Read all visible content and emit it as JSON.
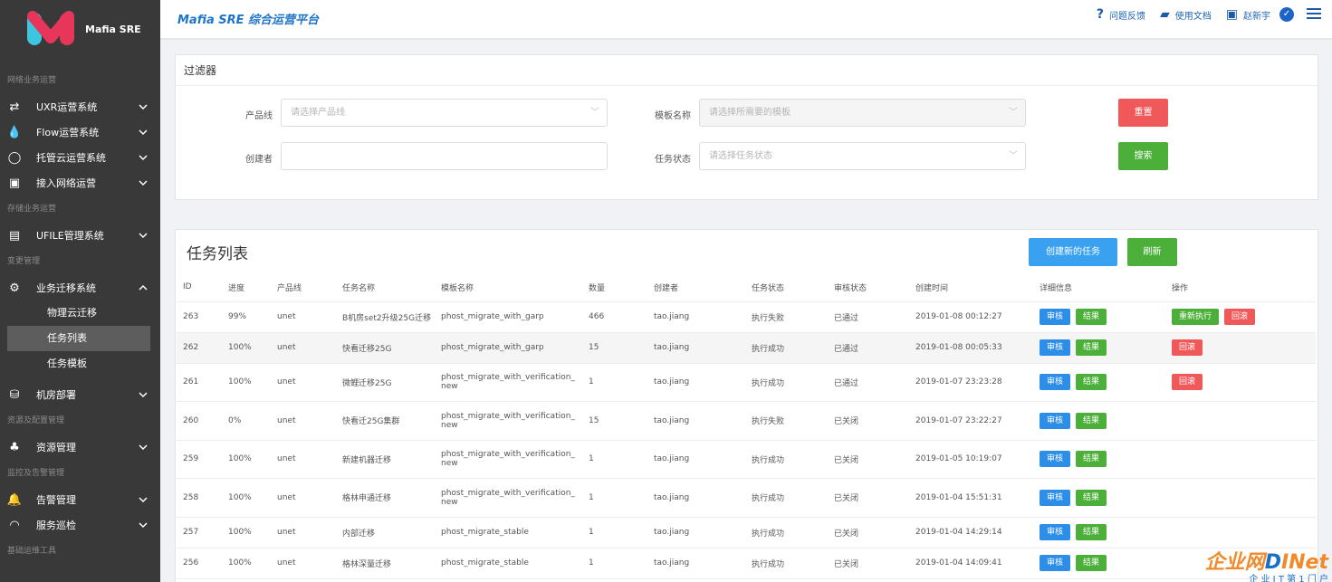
{
  "app": {
    "brand": "Mafia SRE",
    "title": "Mafia SRE 综合运营平台"
  },
  "header": {
    "feedback": "问题反馈",
    "docs": "使用文档",
    "user": "赵新宇"
  },
  "sidebar": {
    "sections": [
      "网络业务运营",
      "存储业务运营",
      "变更管理",
      "资源及配置管理",
      "监控及告警管理",
      "基础运维工具"
    ],
    "items": {
      "uxr": "UXR运营系统",
      "flow": "Flow运营系统",
      "cloud": "托管云运营系统",
      "access": "接入网络运营",
      "ufile": "UFILE管理系统",
      "migrate": "业务迁移系统",
      "sub1": "物理云迁移",
      "sub2": "任务列表",
      "sub3": "任务模板",
      "deploy": "机房部署",
      "resource": "资源管理",
      "alarm": "告警管理",
      "patrol": "服务巡检"
    }
  },
  "filter": {
    "title": "过滤器",
    "product_label": "产品线",
    "product_placeholder": "请选择产品线",
    "template_label": "模板名称",
    "template_placeholder": "请选择所需要的模板",
    "creator_label": "创建者",
    "status_label": "任务状态",
    "status_placeholder": "请选择任务状态",
    "reset": "重置",
    "search": "搜索"
  },
  "list": {
    "title": "任务列表",
    "create": "创建新的任务",
    "refresh": "刷新",
    "columns": [
      "ID",
      "进度",
      "产品线",
      "任务名称",
      "模板名称",
      "数量",
      "创建者",
      "任务状态",
      "审核状态",
      "创建时间",
      "详细信息",
      "操作"
    ],
    "btn_review": "审核",
    "btn_result": "结果",
    "btn_rerun": "重新执行",
    "btn_rollback": "回滚",
    "rows": [
      {
        "id": "263",
        "progress": "99%",
        "product": "unet",
        "name": "B机房set2升级25G迁移",
        "template": "phost_migrate_with_garp",
        "qty": "466",
        "creator": "tao.jiang",
        "status": "执行失败",
        "audit": "已通过",
        "time": "2019-01-08 00:12:27"
      },
      {
        "id": "262",
        "progress": "100%",
        "product": "unet",
        "name": "快看迁移25G",
        "template": "phost_migrate_with_garp",
        "qty": "15",
        "creator": "tao.jiang",
        "status": "执行成功",
        "audit": "已通过",
        "time": "2019-01-08 00:05:33"
      },
      {
        "id": "261",
        "progress": "100%",
        "product": "unet",
        "name": "微鲤迁移25G",
        "template": "phost_migrate_with_verification_new",
        "qty": "1",
        "creator": "tao.jiang",
        "status": "执行成功",
        "audit": "已通过",
        "time": "2019-01-07 23:23:28"
      },
      {
        "id": "260",
        "progress": "0%",
        "product": "unet",
        "name": "快看迁25G集群",
        "template": "phost_migrate_with_verification_new",
        "qty": "15",
        "creator": "tao.jiang",
        "status": "执行失败",
        "audit": "已关闭",
        "time": "2019-01-07 23:22:27"
      },
      {
        "id": "259",
        "progress": "100%",
        "product": "unet",
        "name": "新建机器迁移",
        "template": "phost_migrate_with_verification_new",
        "qty": "1",
        "creator": "tao.jiang",
        "status": "执行成功",
        "audit": "已关闭",
        "time": "2019-01-05 10:19:07"
      },
      {
        "id": "258",
        "progress": "100%",
        "product": "unet",
        "name": "格林申通迁移",
        "template": "phost_migrate_with_verification_new",
        "qty": "1",
        "creator": "tao.jiang",
        "status": "执行成功",
        "audit": "已关闭",
        "time": "2019-01-04 15:51:31"
      },
      {
        "id": "257",
        "progress": "100%",
        "product": "unet",
        "name": "内部迁移",
        "template": "phost_migrate_stable",
        "qty": "1",
        "creator": "tao.jiang",
        "status": "执行成功",
        "audit": "已关闭",
        "time": "2019-01-04 14:29:14"
      },
      {
        "id": "256",
        "progress": "100%",
        "product": "unet",
        "name": "格林深量迁移",
        "template": "phost_migrate_stable",
        "qty": "1",
        "creator": "tao.jiang",
        "status": "执行成功",
        "audit": "已关闭",
        "time": "2019-01-04 14:09:41"
      }
    ]
  },
  "watermark": {
    "text1": "企业网",
    "text2": "D",
    "text3": "INet",
    "sub": "企 业 I T 第 1 门 户"
  }
}
